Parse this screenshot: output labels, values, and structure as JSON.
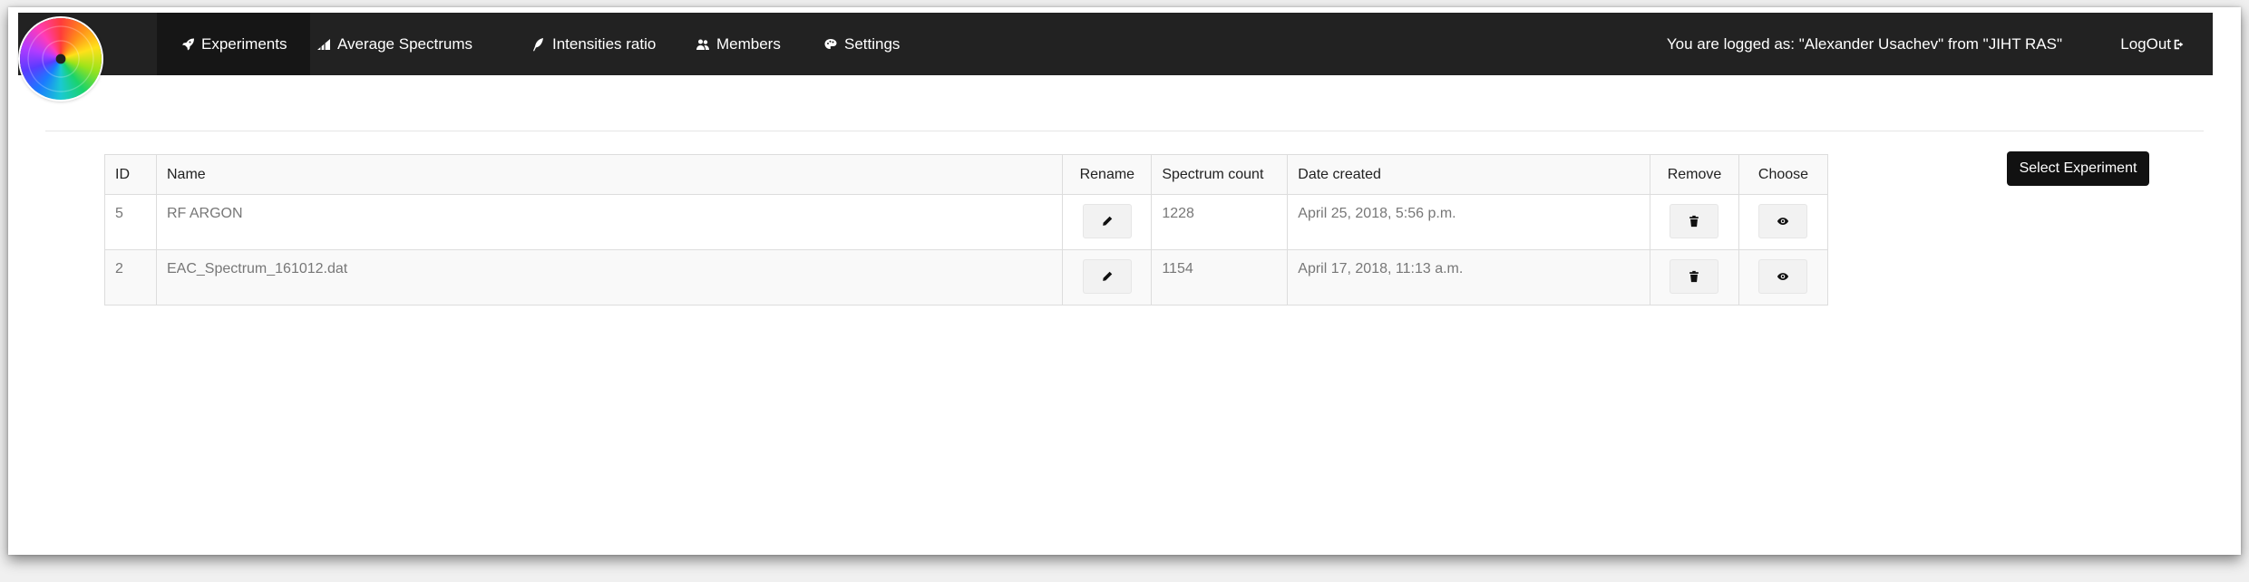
{
  "nav": {
    "items": [
      {
        "label": "Experiments",
        "icon": "rocket-icon",
        "active": true
      },
      {
        "label": "Average Spectrums",
        "icon": "signal-icon",
        "active": false
      },
      {
        "label": "Intensities ratio",
        "icon": "feather-icon",
        "active": false
      },
      {
        "label": "Members",
        "icon": "users-icon",
        "active": false
      },
      {
        "label": "Settings",
        "icon": "palette-icon",
        "active": false
      }
    ],
    "user_text": "You are logged as: \"Alexander Usachev\" from \"JIHT RAS\"",
    "logout_label": "LogOut",
    "logout_icon": "logout-icon"
  },
  "logo": {
    "icon": "color-wheel-icon"
  },
  "table": {
    "headers": {
      "id": "ID",
      "name": "Name",
      "rename": "Rename",
      "spectrum_count": "Spectrum count",
      "date_created": "Date created",
      "remove": "Remove",
      "choose": "Choose"
    },
    "rows": [
      {
        "id": "5",
        "name": "RF ARGON",
        "spectrum_count": "1228",
        "date_created": "April 25, 2018, 5:56 p.m."
      },
      {
        "id": "2",
        "name": "EAC_Spectrum_161012.dat",
        "spectrum_count": "1154",
        "date_created": "April 17, 2018, 11:13 a.m."
      }
    ],
    "row_icons": {
      "rename": "pencil-icon",
      "remove": "trash-icon",
      "choose": "eye-icon"
    }
  },
  "actions": {
    "select_experiment_label": "Select Experiment"
  },
  "colors": {
    "navbar": "#222222",
    "button_primary": "#111111",
    "table_border": "#dddddd"
  }
}
